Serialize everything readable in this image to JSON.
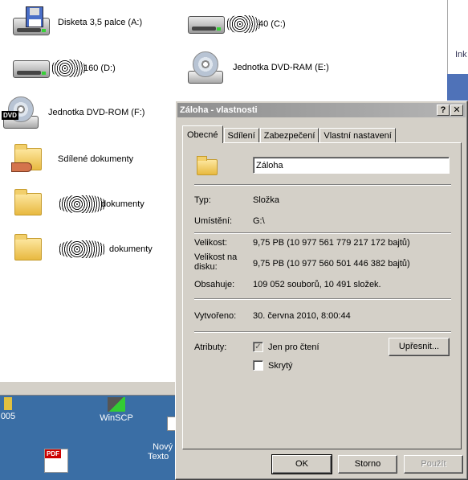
{
  "explorer": {
    "drives": [
      {
        "label": "Disketa 3,5 palce (A:)",
        "icon": "floppy-icon"
      },
      {
        "label": "40 (C:)",
        "icon": "hard-drive-icon"
      },
      {
        "label": "160 (D:)",
        "icon": "hard-drive-icon"
      },
      {
        "label": "Jednotka DVD-RAM (E:)",
        "icon": "dvd-ram-drive-icon"
      },
      {
        "label": "Jednotka DVD-ROM (F:)",
        "icon": "dvd-rom-drive-icon"
      },
      {
        "label": "Sdílené dokumenty",
        "icon": "shared-folder-icon"
      },
      {
        "label": "dokumenty",
        "icon": "folder-icon"
      },
      {
        "label": "dokumenty",
        "icon": "folder-icon"
      }
    ],
    "dvd_badge": "DVD",
    "right_edge_text": "Ink"
  },
  "desktop": {
    "icons": [
      {
        "label": "005",
        "icon": "app-icon"
      },
      {
        "label": "WinSCP",
        "icon": "winscp-icon"
      },
      {
        "label": "Nový\nTexto",
        "icon": "text-document-icon"
      },
      {
        "label": "",
        "icon": "pdf-icon"
      }
    ],
    "pdf_badge": "PDF"
  },
  "dialog": {
    "title": "Záloha - vlastnosti",
    "help_label": "?",
    "close_label": "✕",
    "tabs": [
      "Obecné",
      "Sdílení",
      "Zabezpečení",
      "Vlastní nastavení"
    ],
    "name_value": "Záloha",
    "props": {
      "type_label": "Typ:",
      "type_value": "Složka",
      "location_label": "Umístění:",
      "location_value": "G:\\",
      "size_label": "Velikost:",
      "size_value": "9,75 PB (10 977 561 779 217 172 bajtů)",
      "disk_size_label": "Velikost na disku:",
      "disk_size_value": "9,75 PB (10 977 560 501 446 382 bajtů)",
      "contains_label": "Obsahuje:",
      "contains_value": "109 052 souborů, 10 491 složek.",
      "created_label": "Vytvořeno:",
      "created_value": "30. června 2010, 8:00:44",
      "attributes_label": "Atributy:",
      "readonly_label": "Jen pro čtení",
      "readonly_checked": true,
      "hidden_label": "Skrytý",
      "hidden_checked": false,
      "advanced_label": "Upřesnit..."
    },
    "buttons": {
      "ok": "OK",
      "cancel": "Storno",
      "apply": "Použít"
    }
  }
}
